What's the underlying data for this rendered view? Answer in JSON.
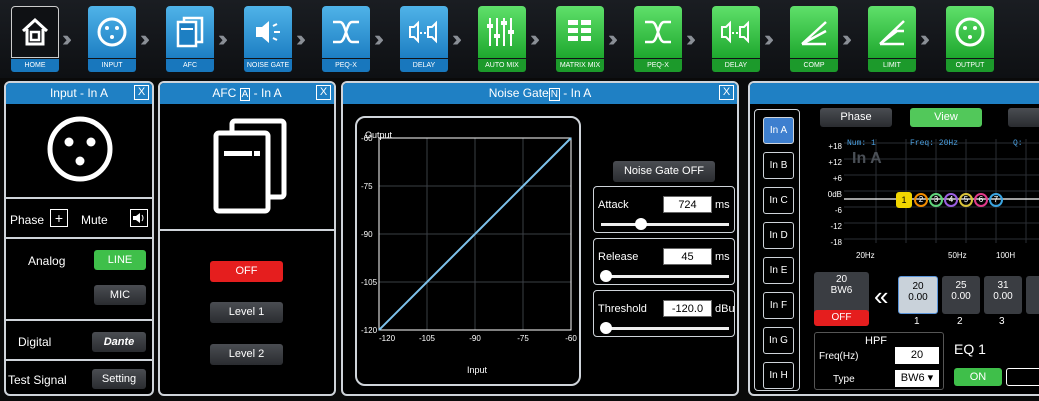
{
  "toolbar": {
    "items": [
      {
        "label": "HOME"
      },
      {
        "label": "INPUT"
      },
      {
        "label": "AFC"
      },
      {
        "label": "NOISE GATE"
      },
      {
        "label": "PEQ-X"
      },
      {
        "label": "DELAY"
      },
      {
        "label": "AUTO MIX"
      },
      {
        "label": "MATRIX MIX"
      },
      {
        "label": "PEQ-X"
      },
      {
        "label": "DELAY"
      },
      {
        "label": "COMP"
      },
      {
        "label": "LIMIT"
      },
      {
        "label": "OUTPUT"
      }
    ]
  },
  "input_panel": {
    "title": "Input - In A",
    "close": "X",
    "phase": "Phase",
    "phase_btn": "+",
    "mute": "Mute",
    "analog": "Analog",
    "line": "LINE",
    "mic": "MIC",
    "digital": "Digital",
    "dante": "Dante",
    "test_signal": "Test Signal",
    "setting": "Setting"
  },
  "afc_panel": {
    "title": "AFC",
    "badge": "A",
    "suffix": "- In A",
    "close": "X",
    "off": "OFF",
    "level1": "Level 1",
    "level2": "Level 2"
  },
  "ng_panel": {
    "title": "Noise Gate",
    "badge": "N",
    "suffix": "- In A",
    "close": "X",
    "chart_label_y": "Output",
    "chart_label_x": "Input",
    "ng_off": "Noise Gate OFF",
    "attack": {
      "label": "Attack",
      "value": "724",
      "unit": "ms",
      "level": 0.3
    },
    "release": {
      "label": "Release",
      "value": "45",
      "unit": "ms",
      "level": 0.02
    },
    "threshold": {
      "label": "Threshold",
      "value": "-120.0",
      "unit": "dBu",
      "level": 0.02
    }
  },
  "chart_data": {
    "type": "line",
    "xlabel": "Input",
    "ylabel": "Output",
    "x_ticks": [
      "-120",
      "-105",
      "-90",
      "-75",
      "-60"
    ],
    "y_ticks": [
      "-60",
      "-75",
      "-90",
      "-105",
      "-120"
    ],
    "xlim": [
      -120,
      -60
    ],
    "ylim": [
      -120,
      -60
    ],
    "series": [
      {
        "x": [
          -120,
          -60
        ],
        "y": [
          -120,
          -60
        ]
      }
    ],
    "grid": true
  },
  "eq_panel": {
    "tabs": [
      "In A",
      "In B",
      "In C",
      "In D",
      "In E",
      "In F",
      "In G",
      "In H"
    ],
    "phase": "Phase",
    "view": "View",
    "num_label": "Num: 1",
    "freq_label": "Freq: 20Hz",
    "q_label": "Q:",
    "channel": "In A",
    "db_ticks": [
      "+18",
      "+12",
      "+6",
      "0dB",
      "-6",
      "-12",
      "-18"
    ],
    "freq_ticks": [
      "20Hz",
      "50Hz",
      "100H"
    ],
    "markers": [
      "1",
      "2",
      "3",
      "4",
      "5",
      "6",
      "7"
    ],
    "hp_freq": "20",
    "hp_type": "BW6",
    "hp_off": "OFF",
    "chevron": "«",
    "bands": [
      {
        "freq": "20",
        "gain": "0.00",
        "num": "1"
      },
      {
        "freq": "25",
        "gain": "0.00",
        "num": "2"
      },
      {
        "freq": "31",
        "gain": "0.00",
        "num": "3"
      }
    ],
    "hpf": "HPF",
    "freq_hz": "Freq(Hz)",
    "freq_val": "20",
    "type": "Type",
    "type_val": "BW6 ▾",
    "eq1": "EQ 1",
    "on": "ON"
  }
}
